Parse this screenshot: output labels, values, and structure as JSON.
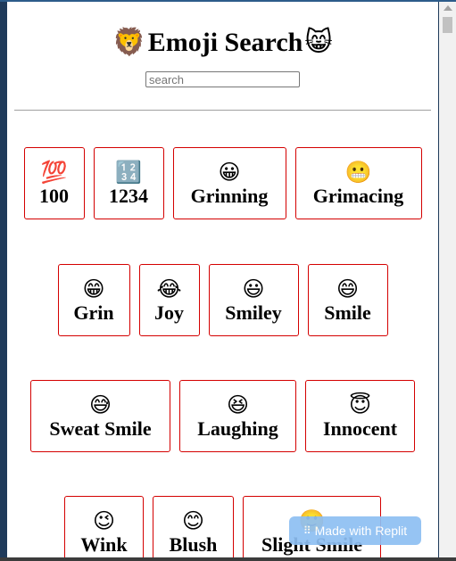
{
  "header": {
    "title": "Emoji Search",
    "left_emoji": "🦁",
    "right_emoji": "😸"
  },
  "search": {
    "placeholder": "search",
    "value": ""
  },
  "results": [
    [
      {
        "emoji": "💯",
        "label": "100"
      },
      {
        "emoji": "🔢",
        "label": "1234"
      },
      {
        "emoji": "😀",
        "label": "Grinning"
      },
      {
        "emoji": "😬",
        "label": "Grimacing"
      }
    ],
    [
      {
        "emoji": "😁",
        "label": "Grin"
      },
      {
        "emoji": "😂",
        "label": "Joy"
      },
      {
        "emoji": "😃",
        "label": "Smiley"
      },
      {
        "emoji": "😄",
        "label": "Smile"
      }
    ],
    [
      {
        "emoji": "😅",
        "label": "Sweat Smile"
      },
      {
        "emoji": "😆",
        "label": "Laughing"
      },
      {
        "emoji": "😇",
        "label": "Innocent"
      }
    ],
    [
      {
        "emoji": "😉",
        "label": "Wink"
      },
      {
        "emoji": "😊",
        "label": "Blush"
      },
      {
        "emoji": "🙂",
        "label": "Slight Smile"
      }
    ]
  ],
  "badge": {
    "label": "Made with Replit",
    "icon": "replit-icon"
  }
}
